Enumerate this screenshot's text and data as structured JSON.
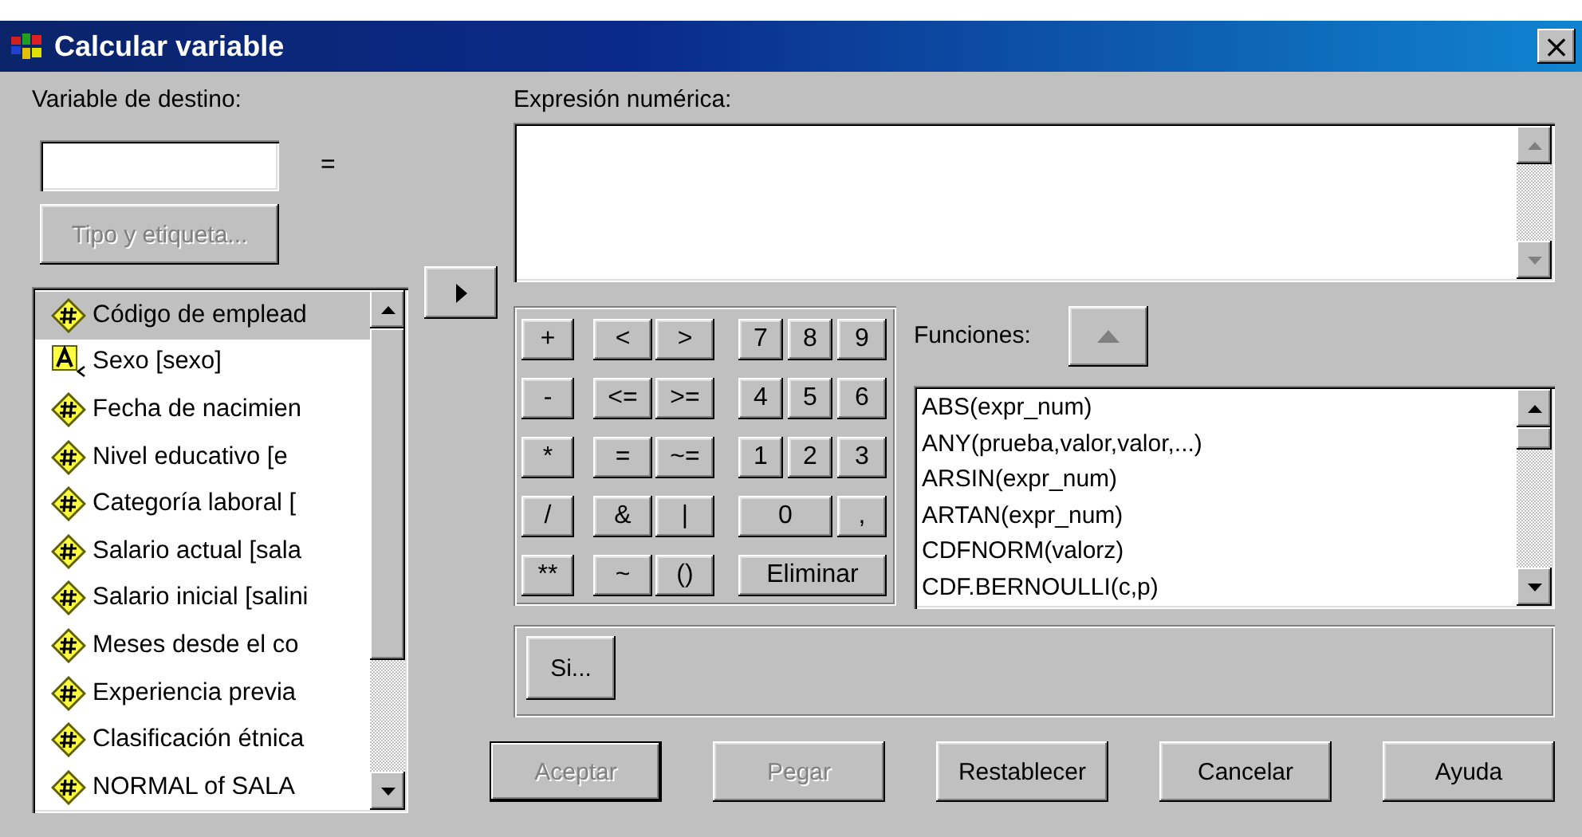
{
  "window": {
    "title": "Calcular variable",
    "close": "×"
  },
  "target": {
    "label": "Variable de destino:",
    "equals": "=",
    "type_button": {
      "label": "Tipo y etiqueta...",
      "disabled": true
    }
  },
  "variables": [
    {
      "name": "Código de emplead",
      "kind": "numeric",
      "selected": true
    },
    {
      "name": "Sexo [sexo]",
      "kind": "string",
      "selected": false
    },
    {
      "name": "Fecha de nacimien",
      "kind": "numeric",
      "selected": false
    },
    {
      "name": "Nivel educativo [e",
      "kind": "numeric",
      "selected": false
    },
    {
      "name": "Categoría laboral [",
      "kind": "numeric",
      "selected": false
    },
    {
      "name": "Salario actual [sala",
      "kind": "numeric",
      "selected": false
    },
    {
      "name": "Salario inicial [salini",
      "kind": "numeric",
      "selected": false
    },
    {
      "name": "Meses desde el co",
      "kind": "numeric",
      "selected": false
    },
    {
      "name": "Experiencia previa",
      "kind": "numeric",
      "selected": false
    },
    {
      "name": "Clasificación étnica",
      "kind": "numeric",
      "selected": false
    },
    {
      "name": "NORMAL of SALA",
      "kind": "numeric",
      "selected": false
    }
  ],
  "expression": {
    "label": "Expresión numérica:"
  },
  "keypad": [
    {
      "operator": "+",
      "relations": [
        "<",
        ">"
      ],
      "digits": [
        "7",
        "8",
        "9"
      ]
    },
    {
      "operator": "-",
      "relations": [
        "<=",
        ">="
      ],
      "digits": [
        "4",
        "5",
        "6"
      ]
    },
    {
      "operator": "*",
      "relations": [
        "=",
        "~="
      ],
      "digits": [
        "1",
        "2",
        "3"
      ]
    },
    {
      "operator": "/",
      "relations": [
        "&",
        "|"
      ],
      "digits": [
        "0",
        ","
      ]
    },
    {
      "operator": "**",
      "relations": [
        "~",
        "()"
      ],
      "digits": [
        "Eliminar"
      ]
    }
  ],
  "functions": {
    "label": "Funciones:",
    "insert_disabled": true,
    "items": [
      "ABS(expr_num)",
      "ANY(prueba,valor,valor,...)",
      "ARSIN(expr_num)",
      "ARTAN(expr_num)",
      "CDFNORM(valorz)",
      "CDF.BERNOULLI(c,p)"
    ]
  },
  "if_button": {
    "label": "Si..."
  },
  "buttons": [
    {
      "label": "Aceptar",
      "disabled": true,
      "default": true
    },
    {
      "label": "Pegar",
      "disabled": true,
      "default": false
    },
    {
      "label": "Restablecer",
      "disabled": false,
      "default": false
    },
    {
      "label": "Cancelar",
      "disabled": false,
      "default": false
    },
    {
      "label": "Ayuda",
      "disabled": false,
      "default": false
    }
  ]
}
